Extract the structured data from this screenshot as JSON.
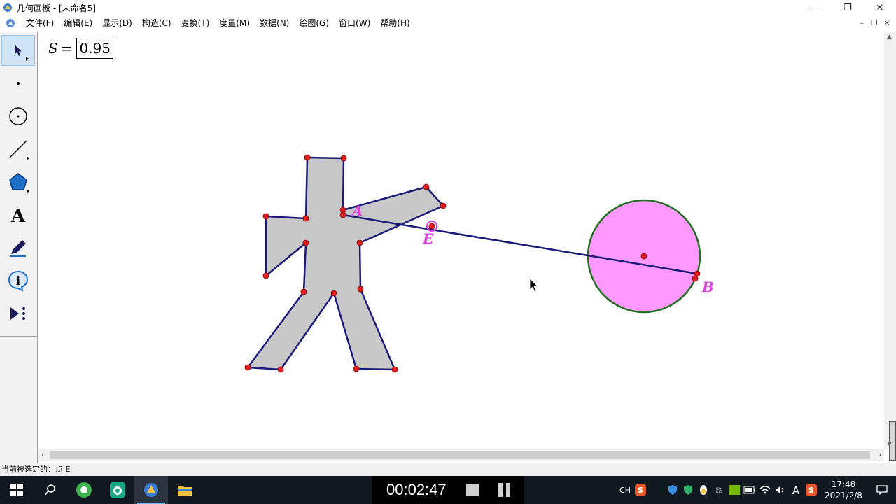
{
  "window": {
    "title": "几何画板 - [未命名5]",
    "minimize": "—",
    "maximize": "❐",
    "close": "✕"
  },
  "menu": [
    "文件(F)",
    "编辑(E)",
    "显示(D)",
    "构造(C)",
    "变换(T)",
    "度量(M)",
    "数据(N)",
    "绘图(G)",
    "窗口(W)",
    "帮助(H)"
  ],
  "mdi": {
    "minimize": "–",
    "restore": "❐",
    "close": "✕"
  },
  "tools": [
    "arrow-select",
    "point",
    "compass",
    "straightedge",
    "polygon",
    "text",
    "marker",
    "information",
    "custom"
  ],
  "measurement": {
    "variable": "S",
    "equals": "=",
    "value": "0.95"
  },
  "labels": {
    "A": "A",
    "E": "E",
    "B": "B"
  },
  "status": "当前被选定的：点 E",
  "taskbar": {
    "timer": "00:02:47",
    "tray_lang": "CH",
    "time": "17:48",
    "date": "2021/2/8"
  },
  "colors": {
    "polygon_fill": "#c8c8c8",
    "polygon_stroke": "#1a1a7a",
    "point": "#e02020",
    "circle_fill": "#ff99ff",
    "circle_stroke": "#207020",
    "label": "#e040e0"
  }
}
